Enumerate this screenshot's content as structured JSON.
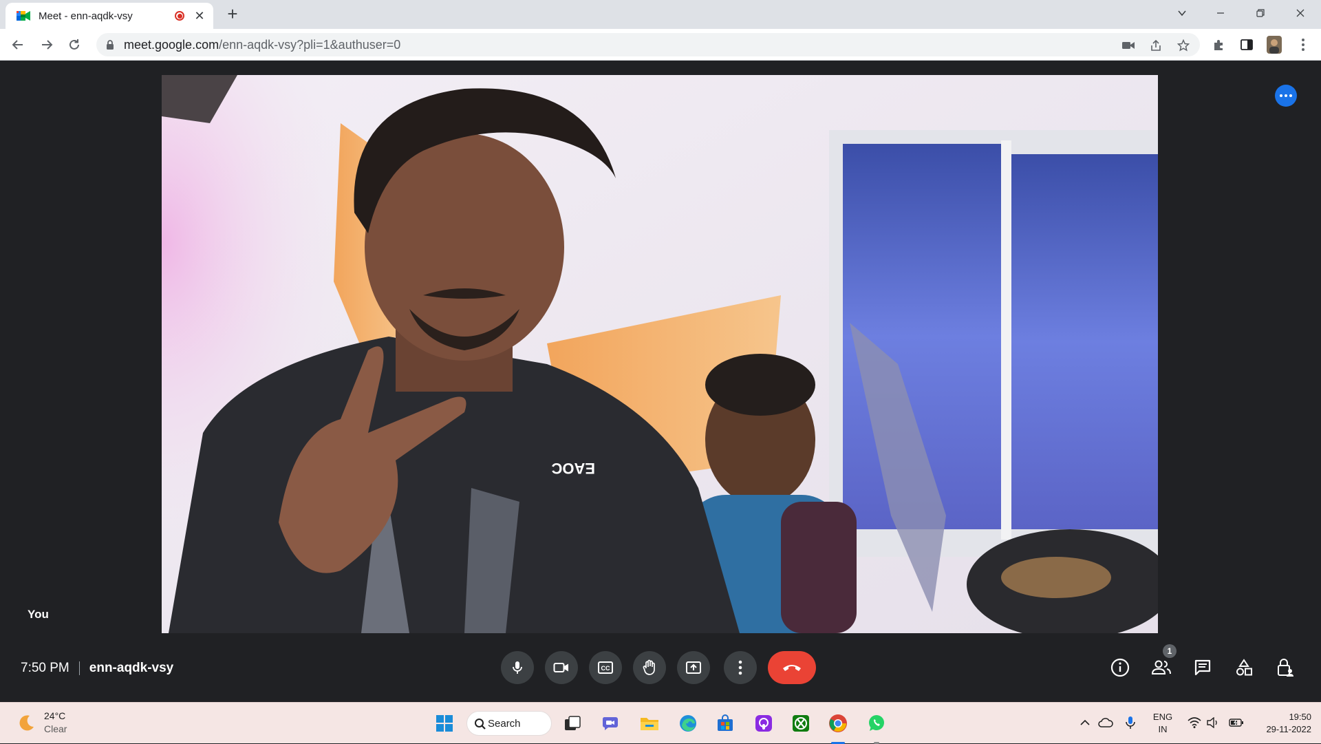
{
  "browser": {
    "tab_title": "Meet - enn-aqdk-vsy",
    "url_domain": "meet.google.com",
    "url_path": "/enn-aqdk-vsy?pli=1&authuser=0",
    "new_tab_label": "+"
  },
  "meet": {
    "self_label": "You",
    "time": "7:50 PM",
    "meeting_code": "enn-aqdk-vsy",
    "participant_count": "1",
    "accent_color": "#1a73e8",
    "hangup_color": "#ea4335"
  },
  "taskbar": {
    "weather_temp": "24°C",
    "weather_condition": "Clear",
    "search_label": "Search",
    "lang_top": "ENG",
    "lang_bottom": "IN",
    "clock_time": "19:50",
    "clock_date": "29-11-2022"
  }
}
